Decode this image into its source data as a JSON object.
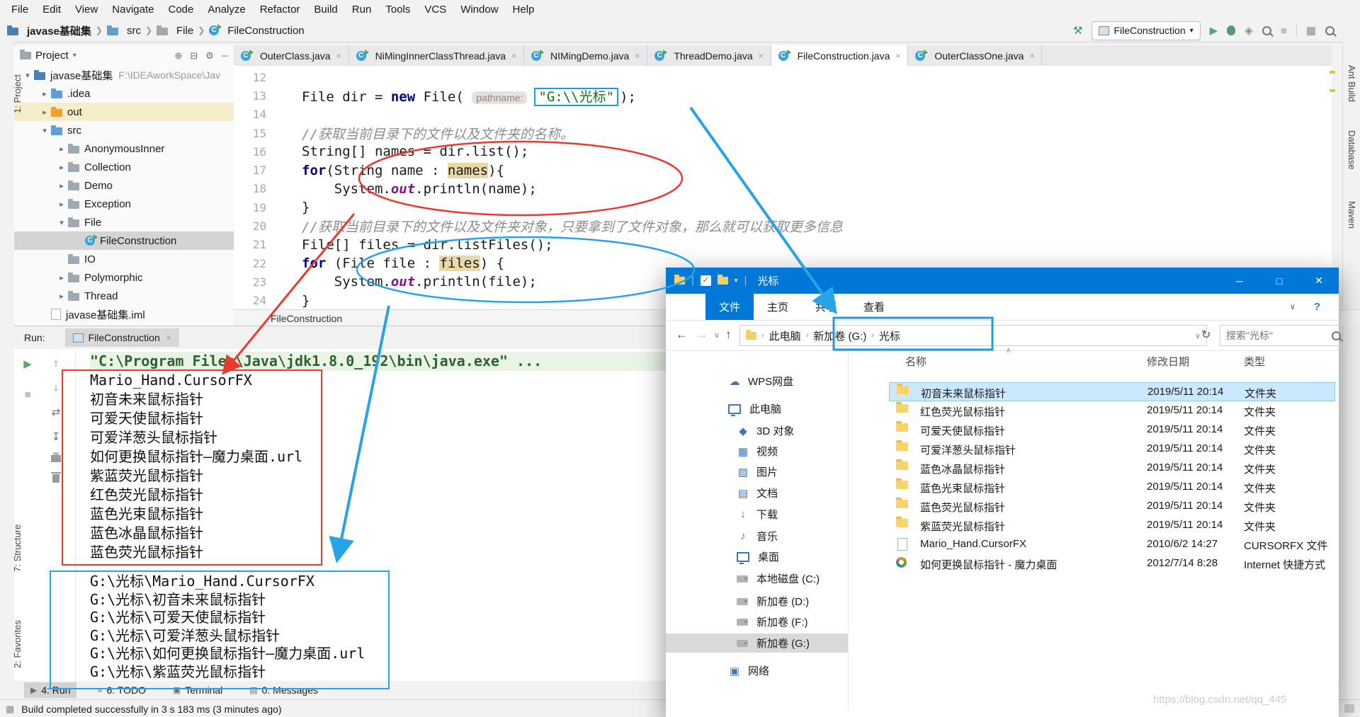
{
  "colors": {
    "explorer_titlebar": "#0078d7",
    "annotation_red": "#ea3a30",
    "annotation_blue": "#28a3e8",
    "run_green": "#59a869"
  },
  "menu": {
    "items": [
      "File",
      "Edit",
      "View",
      "Navigate",
      "Code",
      "Analyze",
      "Refactor",
      "Build",
      "Run",
      "Tools",
      "VCS",
      "Window",
      "Help"
    ]
  },
  "nav_breadcrumb": {
    "items": [
      "javase基础集",
      "src",
      "File",
      "FileConstruction"
    ],
    "icons": [
      "folder-root",
      "folder-blue",
      "package",
      "class"
    ]
  },
  "toolbar": {
    "run_config": "FileConstruction",
    "icons": [
      "build-hammer-icon",
      "run-play-icon",
      "debug-bug-icon",
      "coverage-icon",
      "search-icon",
      "stop-icon",
      "layout-grid-icon",
      "find-icon"
    ]
  },
  "left_strip": {
    "items": [
      "1: Project",
      "7: Structure",
      "2: Favorites"
    ]
  },
  "right_strip": {
    "items": [
      "Ant Build",
      "Database",
      "Maven"
    ]
  },
  "editor_tabs": {
    "tabs": [
      {
        "label": "OuterClass.java",
        "active": false
      },
      {
        "label": "NiMingInnerClassThread.java",
        "active": false
      },
      {
        "label": "NIMingDemo.java",
        "active": false
      },
      {
        "label": "ThreadDemo.java",
        "active": false
      },
      {
        "label": "FileConstruction.java",
        "active": true
      },
      {
        "label": "OuterClassOne.java",
        "active": false
      }
    ]
  },
  "project_panel": {
    "title": "Project",
    "header_icons": [
      "locate-icon",
      "collapse-all-icon",
      "settings-gear-icon",
      "hide-icon"
    ],
    "tree": [
      {
        "label": "javase基础集",
        "suffix": "F:\\IDEAworkSpace\\Jav",
        "level": 0,
        "arrow": "v",
        "icon": "project-folder",
        "row": ""
      },
      {
        "label": ".idea",
        "level": 1,
        "arrow": ">",
        "icon": "folder-blue",
        "row": ""
      },
      {
        "label": "out",
        "level": 1,
        "arrow": ">",
        "icon": "folder-orange",
        "row": "hlY"
      },
      {
        "label": "src",
        "level": 1,
        "arrow": "v",
        "icon": "folder-blue",
        "row": ""
      },
      {
        "label": "AnonymousInner",
        "level": 2,
        "arrow": ">",
        "icon": "package",
        "row": ""
      },
      {
        "label": "Collection",
        "level": 2,
        "arrow": ">",
        "icon": "package",
        "row": ""
      },
      {
        "label": "Demo",
        "level": 2,
        "arrow": ">",
        "icon": "package",
        "row": ""
      },
      {
        "label": "Exception",
        "level": 2,
        "arrow": ">",
        "icon": "package",
        "row": ""
      },
      {
        "label": "File",
        "level": 2,
        "arrow": "v",
        "icon": "package",
        "row": ""
      },
      {
        "label": "FileConstruction",
        "level": 3,
        "arrow": "",
        "icon": "class",
        "row": "sel"
      },
      {
        "label": "IO",
        "level": 2,
        "arrow": "",
        "icon": "package",
        "row": ""
      },
      {
        "label": "Polymorphic",
        "level": 2,
        "arrow": ">",
        "icon": "package",
        "row": ""
      },
      {
        "label": "Thread",
        "level": 2,
        "arrow": ">",
        "icon": "package",
        "row": ""
      },
      {
        "label": "javase基础集.iml",
        "level": 1,
        "arrow": "",
        "icon": "iml-file",
        "row": ""
      }
    ]
  },
  "editor": {
    "breadcrumb": "FileConstruction",
    "lines": [
      {
        "n": "12",
        "seg": []
      },
      {
        "n": "13",
        "seg": [
          {
            "t": "File dir = ",
            "c": "pl"
          },
          {
            "t": "new",
            "c": "kw"
          },
          {
            "t": " File( ",
            "c": "pl"
          },
          {
            "t": "pathname:",
            "c": "hint"
          },
          {
            "t": "\"G:\\\\光标\"",
            "c": "str boxb"
          },
          {
            "t": ");",
            "c": "pl"
          }
        ]
      },
      {
        "n": "14",
        "seg": []
      },
      {
        "n": "15",
        "seg": [
          {
            "t": "//获取当前目录下的文件以及文件夹的名称。",
            "c": "cmt"
          }
        ]
      },
      {
        "n": "16",
        "seg": [
          {
            "t": "String[] names = dir.list();",
            "c": "pl"
          }
        ]
      },
      {
        "n": "17",
        "seg": [
          {
            "t": "for",
            "c": "kw"
          },
          {
            "t": "(String name : ",
            "c": "pl"
          },
          {
            "t": "names",
            "c": "pl hl"
          },
          {
            "t": "){",
            "c": "pl"
          }
        ]
      },
      {
        "n": "18",
        "seg": [
          {
            "t": "    System.",
            "c": "pl"
          },
          {
            "t": "out",
            "c": "field"
          },
          {
            "t": ".println(name);",
            "c": "pl"
          }
        ]
      },
      {
        "n": "19",
        "seg": [
          {
            "t": "}",
            "c": "pl"
          }
        ]
      },
      {
        "n": "20",
        "seg": [
          {
            "t": "//获取当前目录下的文件以及文件夹对象，只要拿到了文件对象，那么就可以获取更多信息",
            "c": "cmt"
          }
        ]
      },
      {
        "n": "21",
        "seg": [
          {
            "t": "File[] files = dir.listFiles();",
            "c": "pl"
          }
        ]
      },
      {
        "n": "22",
        "seg": [
          {
            "t": "for",
            "c": "kw"
          },
          {
            "t": " (File file : ",
            "c": "pl"
          },
          {
            "t": "files",
            "c": "pl hl"
          },
          {
            "t": ") {",
            "c": "pl"
          }
        ]
      },
      {
        "n": "23",
        "seg": [
          {
            "t": "    System.",
            "c": "pl"
          },
          {
            "t": "out",
            "c": "field"
          },
          {
            "t": ".println(file);",
            "c": "pl"
          }
        ]
      },
      {
        "n": "24",
        "seg": [
          {
            "t": "}",
            "c": "pl"
          }
        ]
      }
    ]
  },
  "run_panel": {
    "label": "Run:",
    "tab": "FileConstruction",
    "close": "×",
    "toolbar_left": [
      "rerun-icon",
      "stop-icon"
    ],
    "toolbar_console": [
      "up-stack-trace-icon",
      "down-stack-trace-icon",
      "soft-wrap-icon",
      "scroll-to-end-icon",
      "print-icon",
      "clear-all-icon"
    ],
    "console": {
      "cmd": "\"C:\\Program Files\\Java\\jdk1.8.0_192\\bin\\java.exe\" ...",
      "group1": [
        "Mario_Hand.CursorFX",
        "初音未来鼠标指针",
        "可爱天使鼠标指针",
        "可爱洋葱头鼠标指针",
        "如何更换鼠标指针—魔力桌面.url",
        "紫蓝荧光鼠标指针",
        "红色荧光鼠标指针",
        "蓝色光束鼠标指针",
        "蓝色冰晶鼠标指针",
        "蓝色荧光鼠标指针"
      ],
      "group2": [
        "G:\\光标\\Mario_Hand.CursorFX",
        "G:\\光标\\初音未来鼠标指针",
        "G:\\光标\\可爱天使鼠标指针",
        "G:\\光标\\可爱洋葱头鼠标指针",
        "G:\\光标\\如何更换鼠标指针—魔力桌面.url",
        "G:\\光标\\紫蓝荧光鼠标指针"
      ]
    }
  },
  "bottom_bar": {
    "tabs": [
      {
        "label": "4: Run",
        "icon": "play",
        "active": true
      },
      {
        "label": "6: TODO",
        "icon": "todo",
        "active": false
      },
      {
        "label": "Terminal",
        "icon": "terminal",
        "active": false
      },
      {
        "label": "0: Messages",
        "icon": "messages",
        "active": false
      }
    ]
  },
  "status_bar": {
    "text": "Build completed successfully in 3 s 183 ms (3 minutes ago)"
  },
  "watermark": "https://blog.csdn.net/qq_445",
  "explorer": {
    "title": "光标",
    "window_buttons": [
      "─",
      "□",
      "✕"
    ],
    "ribbon_tabs": [
      {
        "label": "文件",
        "active": true
      },
      {
        "label": "主页",
        "active": false
      },
      {
        "label": "共享",
        "active": false
      },
      {
        "label": "查看",
        "active": false
      }
    ],
    "breadcrumb": [
      "此电脑",
      "新加卷 (G:)",
      "光标"
    ],
    "search_text": "搜索\"光标\"",
    "columns": [
      "名称",
      "修改日期",
      "类型"
    ],
    "sidebar": [
      {
        "label": "WPS网盘",
        "icon": "cloud",
        "child": false,
        "sel": false
      },
      {
        "label": "此电脑",
        "icon": "monitor",
        "child": false,
        "sel": false
      },
      {
        "label": "3D 对象",
        "icon": "cube",
        "child": true,
        "sel": false
      },
      {
        "label": "视频",
        "icon": "video",
        "child": true,
        "sel": false
      },
      {
        "label": "图片",
        "icon": "pictures",
        "child": true,
        "sel": false
      },
      {
        "label": "文档",
        "icon": "docs",
        "child": true,
        "sel": false
      },
      {
        "label": "下载",
        "icon": "download",
        "child": true,
        "sel": false
      },
      {
        "label": "音乐",
        "icon": "music",
        "child": true,
        "sel": false
      },
      {
        "label": "桌面",
        "icon": "desktop",
        "child": true,
        "sel": false
      },
      {
        "label": "本地磁盘 (C:)",
        "icon": "drive",
        "child": true,
        "sel": false
      },
      {
        "label": "新加卷 (D:)",
        "icon": "drive",
        "child": true,
        "sel": false
      },
      {
        "label": "新加卷 (F:)",
        "icon": "drive",
        "child": true,
        "sel": false
      },
      {
        "label": "新加卷 (G:)",
        "icon": "drive",
        "child": true,
        "sel": true
      },
      {
        "label": "网络",
        "icon": "network",
        "child": false,
        "sel": false
      }
    ],
    "files": [
      {
        "name": "初音未来鼠标指针",
        "date": "2019/5/11 20:14",
        "type": "文件夹",
        "icon": "folder",
        "sel": true
      },
      {
        "name": "红色荧光鼠标指针",
        "date": "2019/5/11 20:14",
        "type": "文件夹",
        "icon": "folder",
        "sel": false
      },
      {
        "name": "可爱天使鼠标指针",
        "date": "2019/5/11 20:14",
        "type": "文件夹",
        "icon": "folder",
        "sel": false
      },
      {
        "name": "可爱洋葱头鼠标指针",
        "date": "2019/5/11 20:14",
        "type": "文件夹",
        "icon": "folder",
        "sel": false
      },
      {
        "name": "蓝色冰晶鼠标指针",
        "date": "2019/5/11 20:14",
        "type": "文件夹",
        "icon": "folder",
        "sel": false
      },
      {
        "name": "蓝色光束鼠标指针",
        "date": "2019/5/11 20:14",
        "type": "文件夹",
        "icon": "folder",
        "sel": false
      },
      {
        "name": "蓝色荧光鼠标指针",
        "date": "2019/5/11 20:14",
        "type": "文件夹",
        "icon": "folder",
        "sel": false
      },
      {
        "name": "紫蓝荧光鼠标指针",
        "date": "2019/5/11 20:14",
        "type": "文件夹",
        "icon": "folder",
        "sel": false
      },
      {
        "name": "Mario_Hand.CursorFX",
        "date": "2010/6/2 14:27",
        "type": "CURSORFX 文件",
        "icon": "file",
        "sel": false
      },
      {
        "name": "如何更换鼠标指针 - 魔力桌面",
        "date": "2012/7/14 8:28",
        "type": "Internet 快捷方式",
        "icon": "cursorfx",
        "sel": false
      }
    ]
  }
}
